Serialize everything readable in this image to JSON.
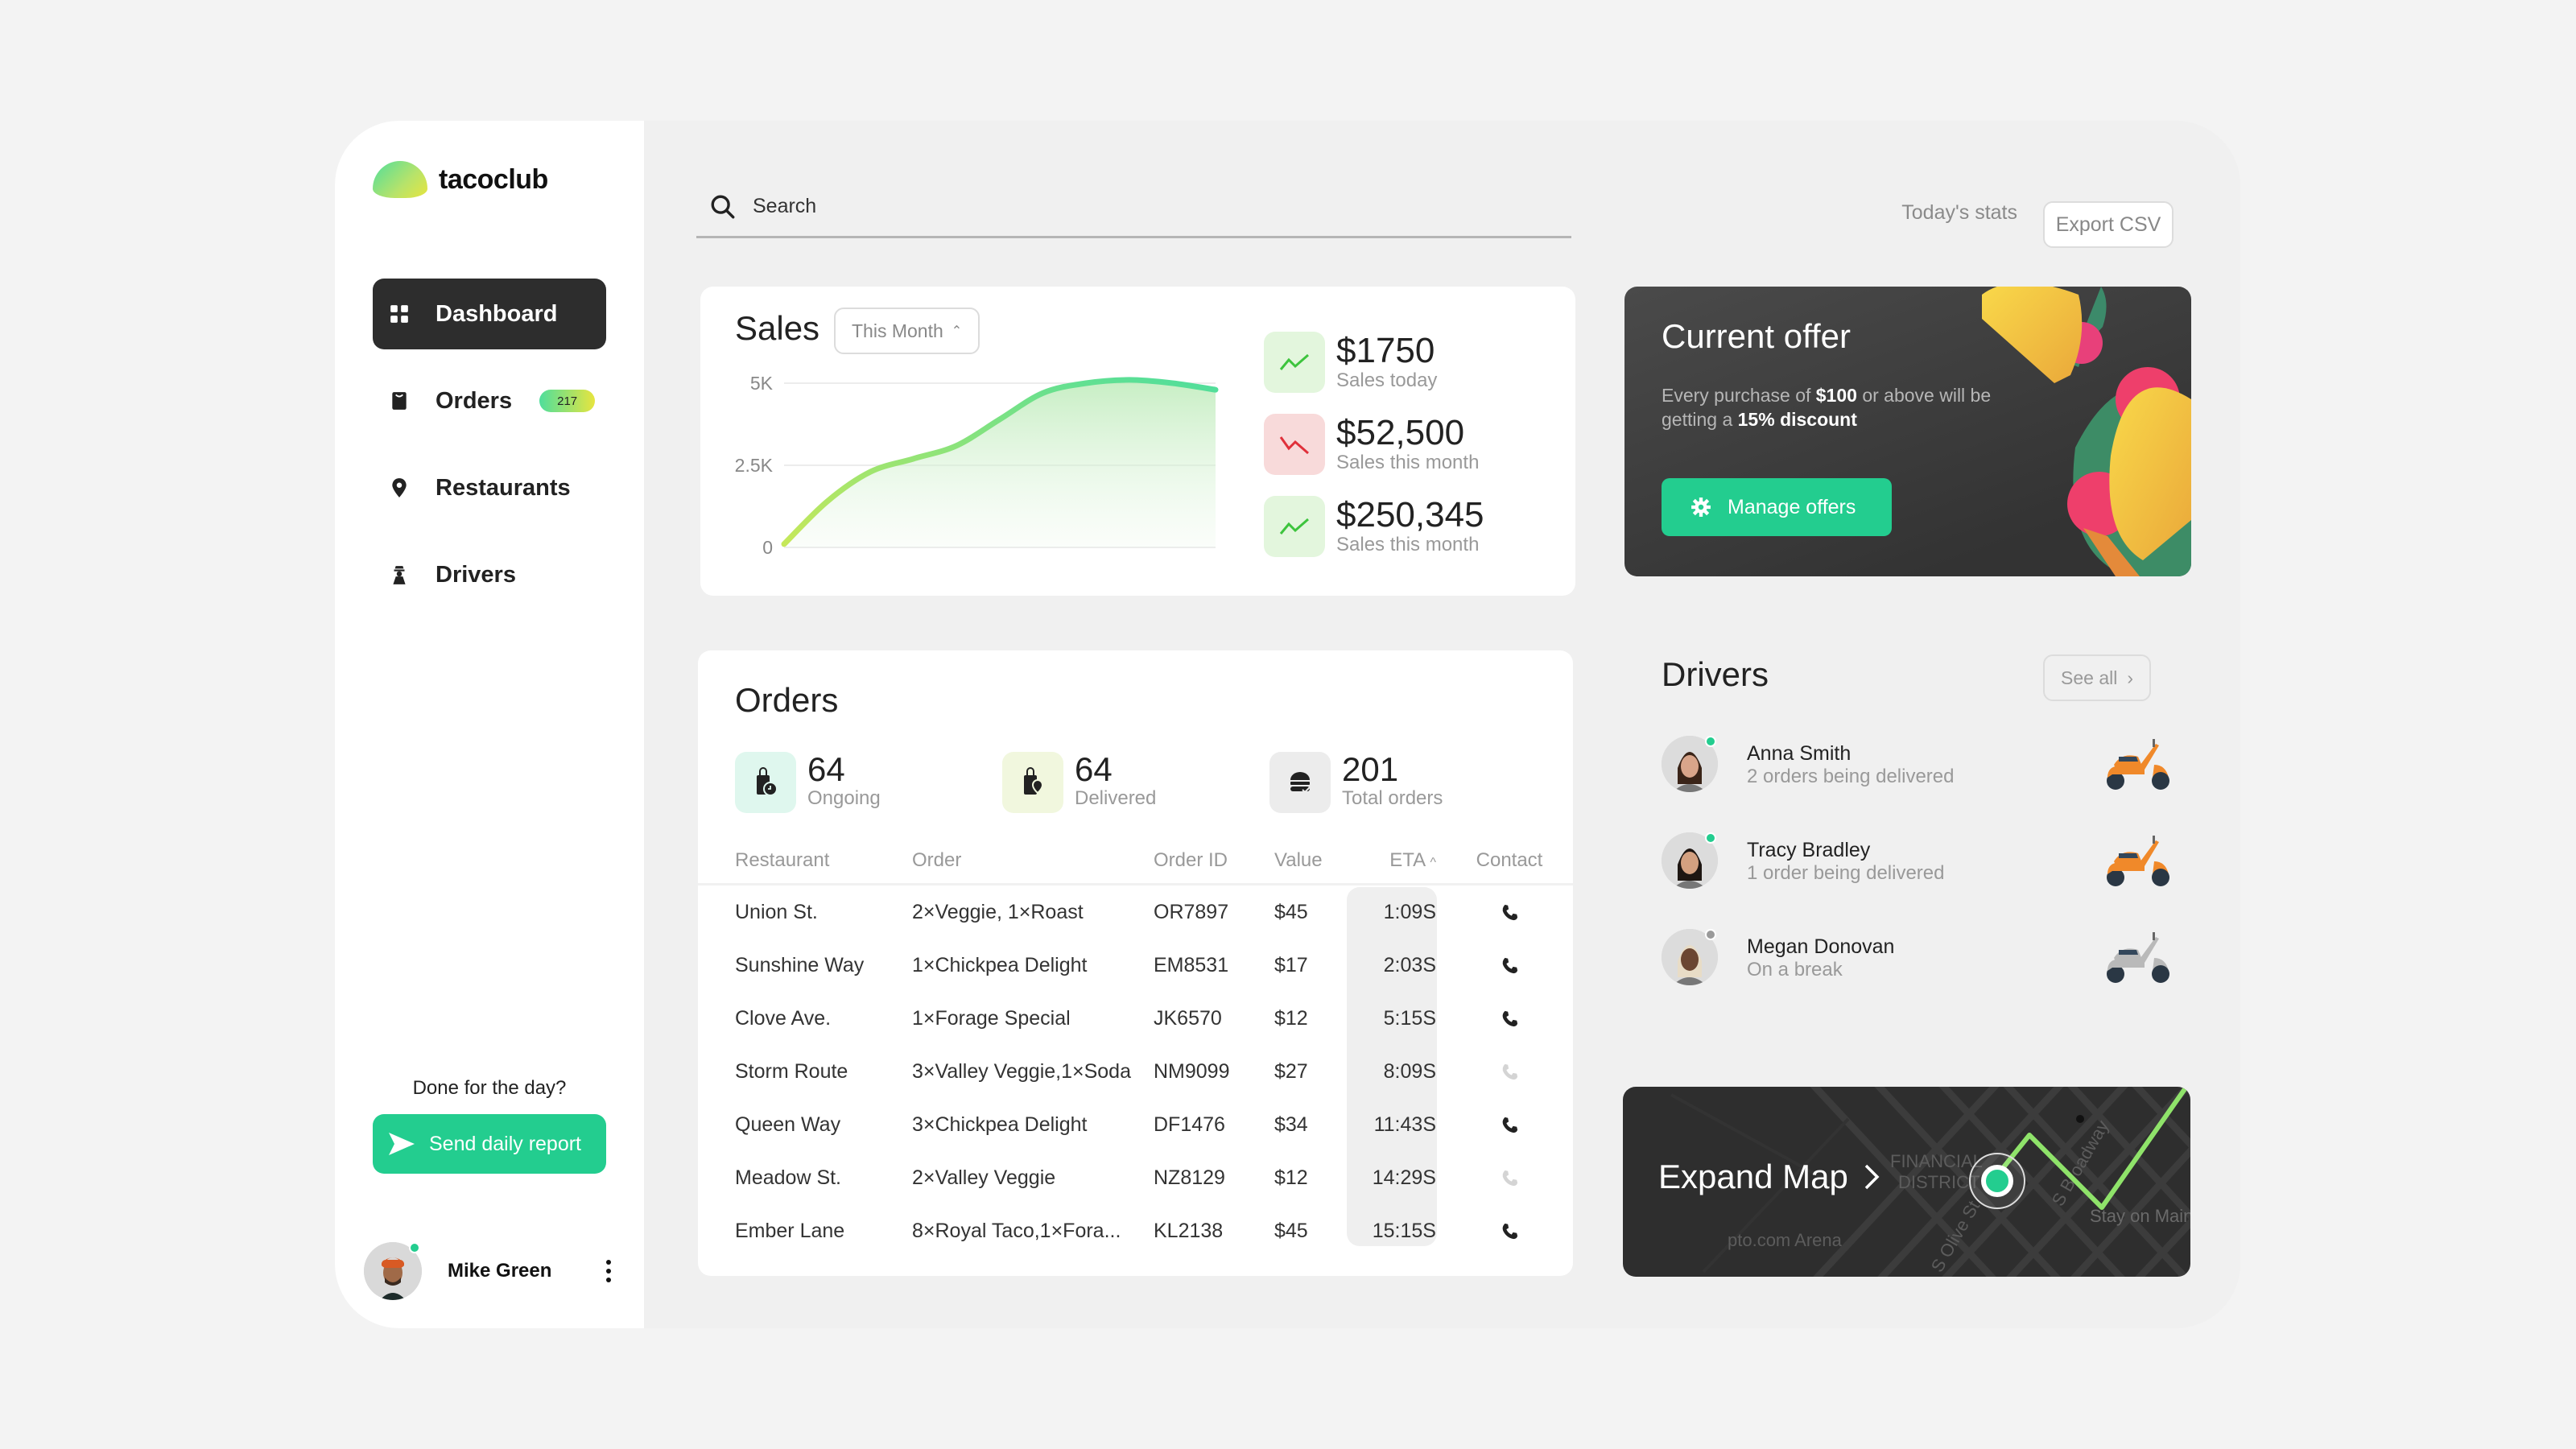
{
  "app": {
    "brand": "tacoclub"
  },
  "sidebar": {
    "items": [
      {
        "label": "Dashboard",
        "icon": "grid-icon",
        "active": true
      },
      {
        "label": "Orders",
        "icon": "bag-icon",
        "badge": "217"
      },
      {
        "label": "Restaurants",
        "icon": "map-pin-icon"
      },
      {
        "label": "Drivers",
        "icon": "driver-icon"
      }
    ],
    "done_prompt": "Done for the day?",
    "send_report_label": "Send daily report",
    "user": {
      "name": "Mike Green",
      "status": "online"
    }
  },
  "header": {
    "search_placeholder": "Search",
    "today_stats": "Today's stats",
    "export_label": "Export CSV"
  },
  "sales": {
    "title": "Sales",
    "period": "This Month",
    "stats": [
      {
        "value": "$1750",
        "label": "Sales today",
        "trend": "up"
      },
      {
        "value": "$52,500",
        "label": "Sales this month",
        "trend": "down"
      },
      {
        "value": "$250,345",
        "label": "Sales this month",
        "trend": "up"
      }
    ]
  },
  "chart_data": {
    "type": "area",
    "title": "Sales",
    "xlabel": "",
    "ylabel": "",
    "ylim": [
      0,
      5000
    ],
    "yticks": [
      0,
      2500,
      5000
    ],
    "ytick_labels": [
      "0",
      "2.5K",
      "5K"
    ],
    "grid": true,
    "x": [
      0,
      1,
      2,
      3,
      4,
      5,
      6,
      7,
      8,
      9,
      10
    ],
    "series": [
      {
        "name": "Sales",
        "values": [
          100,
          1400,
          2300,
          2700,
          3100,
          3900,
          4700,
          5000,
          5100,
          5000,
          4800
        ]
      }
    ]
  },
  "orders": {
    "title": "Orders",
    "summary": [
      {
        "value": "64",
        "label": "Ongoing",
        "icon": "bag-clock-icon",
        "bg": "#dff7ee"
      },
      {
        "value": "64",
        "label": "Delivered",
        "icon": "bag-check-icon",
        "bg": "#f1f7de"
      },
      {
        "value": "201",
        "label": "Total orders",
        "icon": "burger-icon",
        "bg": "#ececec"
      }
    ],
    "columns": [
      "Restaurant",
      "Order",
      "Order ID",
      "Value",
      "ETA",
      "Contact"
    ],
    "sort_indicator": "^",
    "rows": [
      {
        "restaurant": "Union St.",
        "order": "2×Veggie, 1×Roast",
        "id": "OR7897",
        "value": "$45",
        "eta": "1:09S",
        "contact_enabled": true
      },
      {
        "restaurant": "Sunshine Way",
        "order": "1×Chickpea Delight",
        "id": "EM8531",
        "value": "$17",
        "eta": "2:03S",
        "contact_enabled": true
      },
      {
        "restaurant": "Clove Ave.",
        "order": "1×Forage Special",
        "id": "JK6570",
        "value": "$12",
        "eta": "5:15S",
        "contact_enabled": true
      },
      {
        "restaurant": "Storm Route",
        "order": "3×Valley Veggie,1×Soda",
        "id": "NM9099",
        "value": "$27",
        "eta": "8:09S",
        "contact_enabled": false
      },
      {
        "restaurant": "Queen Way",
        "order": "3×Chickpea Delight",
        "id": "DF1476",
        "value": "$34",
        "eta": "11:43S",
        "contact_enabled": true
      },
      {
        "restaurant": "Meadow St.",
        "order": "2×Valley Veggie",
        "id": "NZ8129",
        "value": "$12",
        "eta": "14:29S",
        "contact_enabled": false
      },
      {
        "restaurant": "Ember Lane",
        "order": "8×Royal Taco,1×Fora...",
        "id": "KL2138",
        "value": "$45",
        "eta": "15:15S",
        "contact_enabled": true
      }
    ]
  },
  "offer": {
    "title": "Current offer",
    "desc_1": "Every purchase of ",
    "desc_amount": "$100",
    "desc_2": " or above will be getting a ",
    "desc_discount": "15% discount",
    "button_label": "Manage offers"
  },
  "drivers": {
    "title": "Drivers",
    "see_all": "See all",
    "list": [
      {
        "name": "Anna Smith",
        "status": "2 orders being delivered",
        "online": true,
        "scooter_color": "#f0892a"
      },
      {
        "name": "Tracy Bradley",
        "status": "1 order being delivered",
        "online": true,
        "scooter_color": "#f0892a"
      },
      {
        "name": "Megan Donovan",
        "status": "On a break",
        "online": false,
        "scooter_color": "#b9b9b9"
      }
    ]
  },
  "map": {
    "label": "Expand Map",
    "labels": [
      "FINANCIAL",
      "DISTRICT",
      "S Broadway",
      "S Olive St",
      "Stay on Main",
      "pto.com Arena"
    ]
  },
  "colors": {
    "accent": "#23cd8f",
    "dark": "#2d2d2d",
    "up": "#3dc43d",
    "down": "#e0303a"
  }
}
